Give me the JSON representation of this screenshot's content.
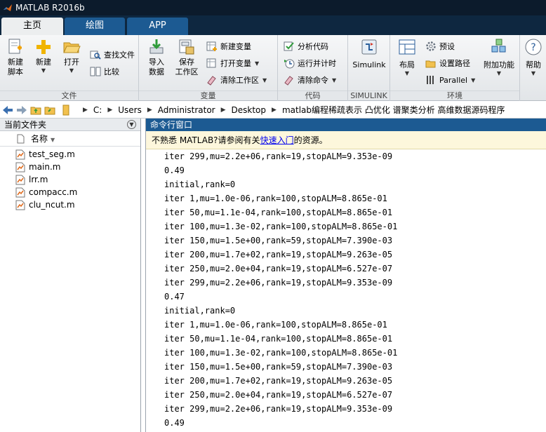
{
  "window": {
    "title": "MATLAB R2016b"
  },
  "tabs": [
    {
      "label": "主页"
    },
    {
      "label": "绘图"
    },
    {
      "label": "APP"
    }
  ],
  "ribbon": {
    "file": {
      "label": "文件",
      "new_script": [
        "新建",
        "脚本"
      ],
      "new": "新建",
      "open": "打开",
      "find_files": "查找文件",
      "compare": "比较"
    },
    "variable": {
      "label": "变量",
      "import": [
        "导入",
        "数据"
      ],
      "save": [
        "保存",
        "工作区"
      ],
      "new_var": "新建变量",
      "open_var": "打开变量",
      "clear_ws": "清除工作区"
    },
    "code": {
      "label": "代码",
      "analyze": "分析代码",
      "run_time": "运行并计时",
      "clear_cmd": "清除命令"
    },
    "simulink": {
      "label": "SIMULINK",
      "simulink": "Simulink"
    },
    "env": {
      "label": "环境",
      "layout": "布局",
      "prefs": "预设",
      "set_path": "设置路径",
      "parallel": "Parallel",
      "addons": "附加功能"
    },
    "resources": {
      "help": "帮助"
    }
  },
  "address": {
    "crumbs": [
      "C:",
      "Users",
      "Administrator",
      "Desktop",
      "matlab编程稀疏表示 凸优化 谱聚类分析 高维数据源码程序"
    ]
  },
  "left_pane": {
    "title": "当前文件夹",
    "column_name": "名称",
    "files": [
      "test_seg.m",
      "main.m",
      "lrr.m",
      "compacc.m",
      "clu_ncut.m"
    ]
  },
  "command_window": {
    "title": "命令行窗口",
    "notice_prefix": "不熟悉 MATLAB?请参阅有关",
    "notice_link": "快速入门",
    "notice_suffix": "的资源。",
    "lines": [
      "iter 299,mu=2.2e+06,rank=19,stopALM=9.353e-09",
      "0.49",
      "initial,rank=0",
      "iter 1,mu=1.0e-06,rank=100,stopALM=8.865e-01",
      "iter 50,mu=1.1e-04,rank=100,stopALM=8.865e-01",
      "iter 100,mu=1.3e-02,rank=100,stopALM=8.865e-01",
      "iter 150,mu=1.5e+00,rank=59,stopALM=7.390e-03",
      "iter 200,mu=1.7e+02,rank=19,stopALM=9.263e-05",
      "iter 250,mu=2.0e+04,rank=19,stopALM=6.527e-07",
      "iter 299,mu=2.2e+06,rank=19,stopALM=9.353e-09",
      "0.47",
      "initial,rank=0",
      "iter 1,mu=1.0e-06,rank=100,stopALM=8.865e-01",
      "iter 50,mu=1.1e-04,rank=100,stopALM=8.865e-01",
      "iter 100,mu=1.3e-02,rank=100,stopALM=8.865e-01",
      "iter 150,mu=1.5e+00,rank=59,stopALM=7.390e-03",
      "iter 200,mu=1.7e+02,rank=19,stopALM=9.263e-05",
      "iter 250,mu=2.0e+04,rank=19,stopALM=6.527e-07",
      "iter 299,mu=2.2e+06,rank=19,stopALM=9.353e-09",
      "0.49"
    ]
  },
  "colors": {
    "titlebar": "#0c1b2c",
    "tabstrip": "#0e2740",
    "tab_inactive": "#1c5a92",
    "accent": "#1c5a92",
    "notice_bg": "#fdf7dc"
  }
}
